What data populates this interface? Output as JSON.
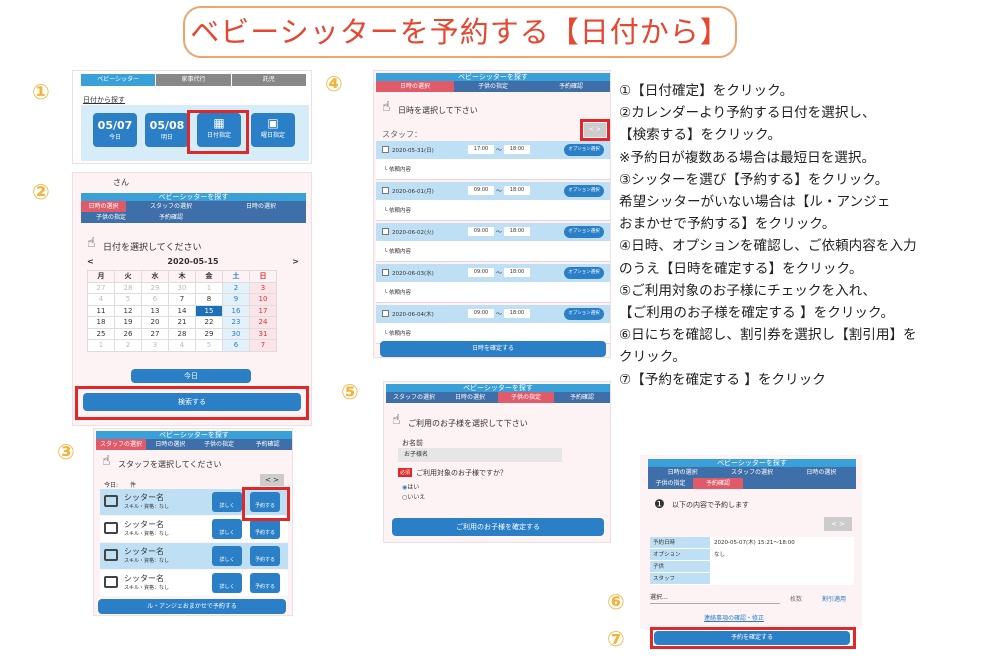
{
  "title": "ベビーシッターを予約する【日付から】",
  "steps": [
    "①",
    "②",
    "③",
    "④",
    "⑤",
    "⑥",
    "⑦"
  ],
  "s1": {
    "tabs": [
      "ベビーシッター",
      "家事代行",
      "託児"
    ],
    "link": "日付から探す",
    "dates": [
      {
        "d": "05/07",
        "s": "今日"
      },
      {
        "d": "05/08",
        "s": "明日"
      }
    ],
    "fix": "日付指定",
    "cal": "曜日指定"
  },
  "s2": {
    "name": "さん",
    "hdr": "ベビーシッターを探す",
    "crumbs": [
      "日時の選択",
      "スタッフの選択",
      "日時の選択",
      "子供の指定",
      "予約確認"
    ],
    "prompt": "日付を選択してください",
    "month": "2020-05-15",
    "wd": [
      "月",
      "火",
      "水",
      "木",
      "金",
      "土",
      "日"
    ],
    "weeks": [
      [
        "27",
        "28",
        "29",
        "30",
        "1",
        "2",
        "3"
      ],
      [
        "4",
        "5",
        "6",
        "7",
        "8",
        "9",
        "10"
      ],
      [
        "11",
        "12",
        "13",
        "14",
        "15",
        "16",
        "17"
      ],
      [
        "18",
        "19",
        "20",
        "21",
        "22",
        "23",
        "24"
      ],
      [
        "25",
        "26",
        "27",
        "28",
        "29",
        "30",
        "31"
      ],
      [
        "1",
        "2",
        "3",
        "4",
        "5",
        "6",
        "7"
      ]
    ],
    "today": "今日",
    "search": "検索する"
  },
  "s3": {
    "hdr": "ベビーシッターを探す",
    "crumbs": [
      "スタッフの選択",
      "日時の選択",
      "子供の指定",
      "予約確認"
    ],
    "prompt": "スタッフを選択してください",
    "today": "今日:　　件",
    "sitters": [
      {
        "n": "シッター名",
        "d": "スキル・資格：なし"
      },
      {
        "n": "シッター名",
        "d": "スキル・資格：なし"
      },
      {
        "n": "シッター名",
        "d": "スキル・資格：なし"
      },
      {
        "n": "シッター名",
        "d": "スキル・資格：なし"
      }
    ],
    "detail": "詳しく",
    "reserve": "予約する",
    "omakase": "ル・アンジェおまかせで予約する"
  },
  "s4": {
    "hdr": "ベビーシッターを探す",
    "crumbs": [
      "日時の選択",
      "子供の指定",
      "予約確認"
    ],
    "prompt": "日時を選択して下さい",
    "staff": "スタッフ：",
    "prev": "<",
    "next": ">",
    "rows": [
      {
        "d": "2020-05-31(日)",
        "t1": "17:00",
        "t2": "18:00"
      },
      {
        "d": "2020-06-01(月)",
        "t1": "09:00",
        "t2": "18:00"
      },
      {
        "d": "2020-06-02(火)",
        "t1": "09:00",
        "t2": "18:00"
      },
      {
        "d": "2020-06-03(水)",
        "t1": "09:00",
        "t2": "18:00"
      },
      {
        "d": "2020-06-04(木)",
        "t1": "09:00",
        "t2": "18:00"
      }
    ],
    "tilde": "〜",
    "opt": "オプション選択",
    "req": "└ 依頼内容",
    "confirm": "日時を確定する"
  },
  "s5": {
    "hdr": "ベビーシッターを探す",
    "crumbs": [
      "スタッフの選択",
      "日時の選択",
      "子供の指定",
      "予約確認"
    ],
    "prompt": "ご利用のお子様を選択して下さい",
    "namelabel": "お名前",
    "child": "お子様名",
    "req": "必須",
    "q": "ご利用対象のお子様ですか？",
    "yes": "はい",
    "no": "いいえ",
    "confirm": "ご利用のお子様を確定する"
  },
  "s6": {
    "hdr": "ベビーシッターを探す",
    "crumbs": [
      "日時の選択",
      "スタッフの選択",
      "日時の選択",
      "子供の指定",
      "予約確認"
    ],
    "info": "以下の内容で予約します",
    "rows": [
      {
        "k": "予約日時",
        "v": "2020-05-07(木) 15:21〜18:00"
      },
      {
        "k": "オプション",
        "v": "なし"
      },
      {
        "k": "子供",
        "v": ""
      },
      {
        "k": "スタッフ",
        "v": ""
      }
    ],
    "select": "選択...",
    "count": "枚数",
    "apply": "割引適用",
    "link": "連絡事項の確認・修正",
    "confirm": "予約を確定する"
  },
  "instructions": [
    "①【日付確定】をクリック。",
    "②カレンダーより予約する日付を選択し、",
    "【検索する】をクリック。",
    "※予約日が複数ある場合は最短日を選択。",
    "③シッターを選び【予約する】をクリック。",
    "希望シッターがいない場合は【ル・アンジェ",
    "おまかせで予約する】をクリック。",
    "④日時、オプションを確認し、ご依頼内容を入力",
    "のうえ【日時を確定する】をクリック。",
    "⑤ご利用対象のお子様にチェックを入れ、",
    "【ご利用のお子様を確定する 】をクリック。",
    "⑥日にちを確認し、割引券を選択し【割引用】を",
    "クリック。",
    "⑦【予約を確定する 】をクリック"
  ]
}
